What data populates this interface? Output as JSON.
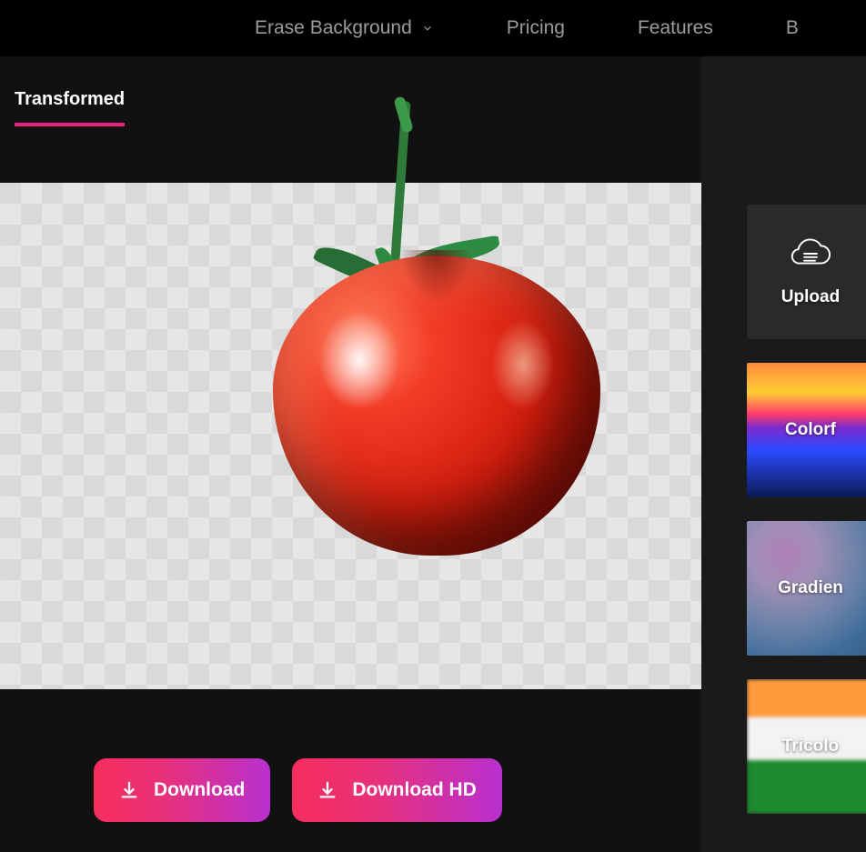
{
  "nav": {
    "items": [
      {
        "label": "Erase Background",
        "hasDropdown": true
      },
      {
        "label": "Pricing",
        "hasDropdown": false
      },
      {
        "label": "Features",
        "hasDropdown": false
      },
      {
        "label": "B",
        "hasDropdown": false
      }
    ]
  },
  "tabbar": {
    "active_label": "Transformed"
  },
  "buttons": {
    "download": "Download",
    "download_hd": "Download HD"
  },
  "sidebar": {
    "upload": "Upload",
    "tiles": [
      {
        "label": "Colorf",
        "kind": "colorful"
      },
      {
        "label": "Gradien",
        "kind": "gradient"
      },
      {
        "label": "Tricolo",
        "kind": "tricolor"
      }
    ]
  }
}
